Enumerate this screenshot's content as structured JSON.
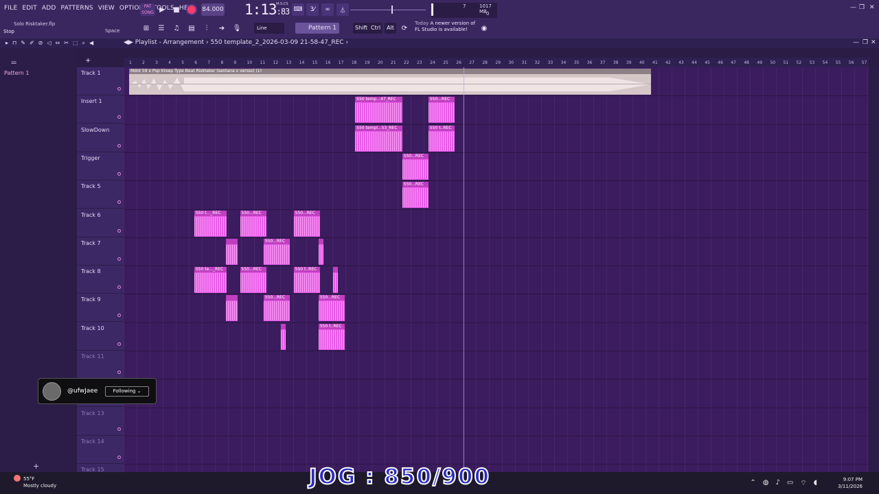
{
  "menu": [
    "FILE",
    "EDIT",
    "ADD",
    "PATTERNS",
    "VIEW",
    "OPTIONS",
    "TOOLS",
    "HELP"
  ],
  "transport": {
    "mode_label": "SONG",
    "tempo": "84.000",
    "time": "1:13",
    "time_frac": "83",
    "time_label": "M:S:CS",
    "cpu_num": "7",
    "memory": "1017 MB",
    "zero": "0"
  },
  "hint": {
    "title": "Solo Risktaker.flp",
    "status": "Stop",
    "key": "Space"
  },
  "toolbar2": {
    "snap": "Line",
    "pattern": "Pattern 1",
    "keys": [
      "Shift",
      "Ctrl",
      "Alt"
    ],
    "news_day": "Today",
    "news_msg1": "A newer version of",
    "news_msg2": "FL Studio is available!"
  },
  "playlist": {
    "crumb": "Playlist - Arrangement",
    "sep": "›",
    "project": "550 template_2_2026-03-09 21-58-47_REC"
  },
  "browser": {
    "item": "Pattern 1"
  },
  "ruler": [
    "1",
    "2",
    "3",
    "4",
    "5",
    "6",
    "7",
    "8",
    "9",
    "10",
    "11",
    "12",
    "13",
    "14",
    "15",
    "16",
    "17",
    "18",
    "19",
    "20",
    "21",
    "22",
    "23",
    "24",
    "25",
    "26",
    "27",
    "28",
    "29",
    "30",
    "31",
    "32",
    "33",
    "34",
    "35",
    "36",
    "37",
    "38",
    "39",
    "40",
    "41",
    "42",
    "43",
    "44",
    "45",
    "46",
    "47",
    "48",
    "49",
    "50",
    "51",
    "52",
    "53",
    "54",
    "55",
    "56",
    "57"
  ],
  "tracks": [
    {
      "name": "Track 1",
      "dim": false
    },
    {
      "name": "Insert 1",
      "dim": false
    },
    {
      "name": "SlowDown",
      "dim": false
    },
    {
      "name": "Trigger",
      "dim": false
    },
    {
      "name": "Track 5",
      "dim": false
    },
    {
      "name": "Track 6",
      "dim": false
    },
    {
      "name": "Track 7",
      "dim": false
    },
    {
      "name": "Track 8",
      "dim": false
    },
    {
      "name": "Track 9",
      "dim": false
    },
    {
      "name": "Track 10",
      "dim": false
    },
    {
      "name": "Track 11",
      "dim": true
    },
    {
      "name": "",
      "dim": true
    },
    {
      "name": "Track 13",
      "dim": true
    },
    {
      "name": "Track 14",
      "dim": true
    },
    {
      "name": "Track 15",
      "dim": true
    }
  ],
  "main_audio": {
    "label": "Mdot 59 x Pop Kreep Type Beat Risktaker (santana x versss) (1)"
  },
  "clips": [
    {
      "track": 1,
      "start": 17.7,
      "len": 3.6,
      "label": "550 temp...47_REC"
    },
    {
      "track": 1,
      "start": 23.3,
      "len": 2.0,
      "label": "550...REC"
    },
    {
      "track": 2,
      "start": 17.7,
      "len": 3.6,
      "label": "550 templ...53_REC"
    },
    {
      "track": 2,
      "start": 23.3,
      "len": 2.0,
      "label": "550 t..REC"
    },
    {
      "track": 3,
      "start": 21.3,
      "len": 2.0,
      "label": "550...REC"
    },
    {
      "track": 4,
      "start": 21.3,
      "len": 2.0,
      "label": "550...REC"
    },
    {
      "track": 5,
      "start": 5.4,
      "len": 2.5,
      "label": "550 t..._REC"
    },
    {
      "track": 5,
      "start": 8.9,
      "len": 2.0,
      "label": "550...REC"
    },
    {
      "track": 5,
      "start": 13.0,
      "len": 2.0,
      "label": "550...REC"
    },
    {
      "track": 6,
      "start": 7.8,
      "len": 0.9,
      "label": ""
    },
    {
      "track": 6,
      "start": 10.7,
      "len": 2.0,
      "label": "550...REC"
    },
    {
      "track": 6,
      "start": 14.9,
      "len": 0.4,
      "label": ""
    },
    {
      "track": 7,
      "start": 5.4,
      "len": 2.5,
      "label": "550 te..._REC"
    },
    {
      "track": 7,
      "start": 8.9,
      "len": 2.0,
      "label": "550...REC"
    },
    {
      "track": 7,
      "start": 13.0,
      "len": 2.0,
      "label": "550 t..REC"
    },
    {
      "track": 7,
      "start": 16.0,
      "len": 0.4,
      "label": ""
    },
    {
      "track": 8,
      "start": 7.8,
      "len": 0.9,
      "label": ""
    },
    {
      "track": 8,
      "start": 10.7,
      "len": 2.0,
      "label": "550...REC"
    },
    {
      "track": 8,
      "start": 14.9,
      "len": 2.0,
      "label": "550...REC"
    },
    {
      "track": 9,
      "start": 12.0,
      "len": 0.4,
      "label": ""
    },
    {
      "track": 9,
      "start": 14.9,
      "len": 2.0,
      "label": "550 t..REC"
    }
  ],
  "follow": {
    "handle": "@ufwJaee",
    "button": "Following ⌄"
  },
  "taskbar": {
    "temp": "55°F",
    "weather": "Mostly cloudy",
    "time": "9:07 PM",
    "date": "3/11/2026"
  },
  "overlay": "JOG : 850/900"
}
